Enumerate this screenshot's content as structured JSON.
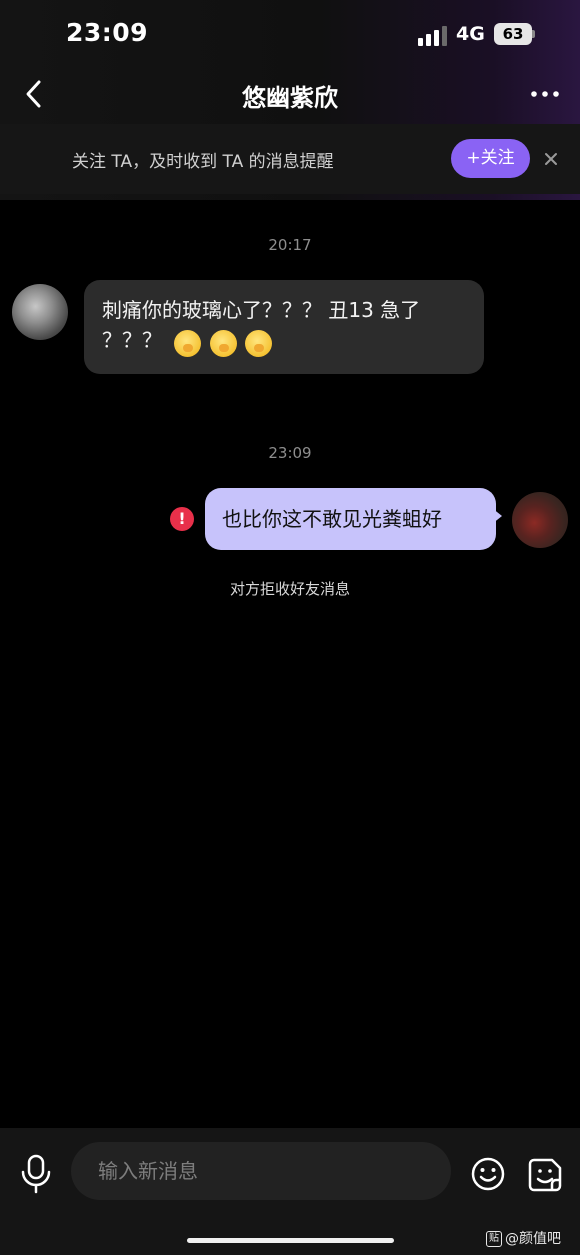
{
  "status_bar": {
    "time": "23:09",
    "network": "4G",
    "battery": "63"
  },
  "nav": {
    "title": "悠幽紫欣"
  },
  "follow_banner": {
    "text": "关注 TA，及时收到 TA 的消息提醒",
    "button_label": "+关注"
  },
  "messages": [
    {
      "timestamp": "20:17"
    },
    {
      "direction": "received",
      "text_line1": "刺痛你的玻璃心了？？？ 丑13  急了",
      "text_line2": "？？？"
    },
    {
      "timestamp": "23:09"
    },
    {
      "direction": "sent",
      "text": "也比你这不敢见光粪蛆好",
      "status": "failed"
    }
  ],
  "system_notice": "对方拒收好友消息",
  "input": {
    "placeholder": "输入新消息"
  },
  "watermark": {
    "badge": "贴",
    "text": "@颜值吧"
  },
  "colors": {
    "accent": "#8a63f4",
    "sent_bubble": "#c7c3fb",
    "received_bubble": "#2c2c2c",
    "error": "#e8304a"
  }
}
